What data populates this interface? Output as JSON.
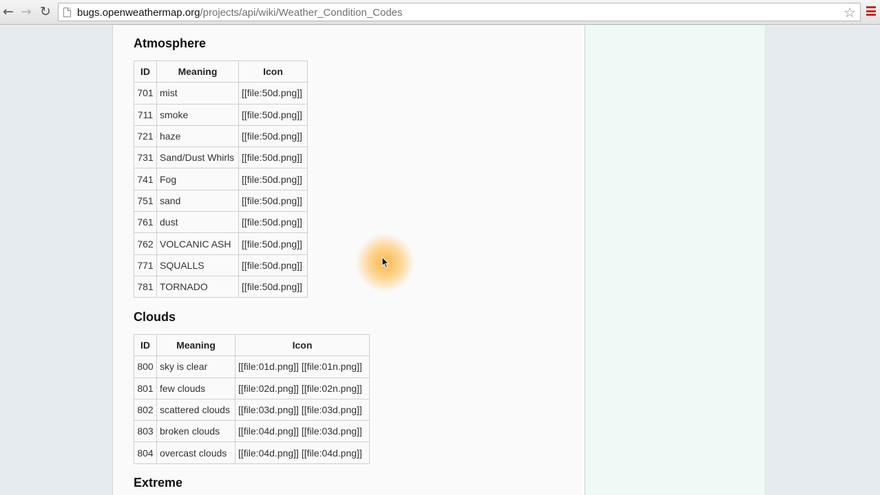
{
  "browser": {
    "url_host": "bugs.openweathermap.org",
    "url_path": "/projects/api/wiki/Weather_Condition_Codes"
  },
  "atmosphere": {
    "title": "Atmosphere",
    "headers": [
      "ID",
      "Meaning",
      "Icon"
    ],
    "rows": [
      [
        "701",
        "mist",
        "[[file:50d.png]]"
      ],
      [
        "711",
        "smoke",
        "[[file:50d.png]]"
      ],
      [
        "721",
        "haze",
        "[[file:50d.png]]"
      ],
      [
        "731",
        "Sand/Dust Whirls",
        "[[file:50d.png]]"
      ],
      [
        "741",
        "Fog",
        "[[file:50d.png]]"
      ],
      [
        "751",
        "sand",
        "[[file:50d.png]]"
      ],
      [
        "761",
        "dust",
        "[[file:50d.png]]"
      ],
      [
        "762",
        "VOLCANIC ASH",
        "[[file:50d.png]]"
      ],
      [
        "771",
        "SQUALLS",
        "[[file:50d.png]]"
      ],
      [
        "781",
        "TORNADO",
        "[[file:50d.png]]"
      ]
    ]
  },
  "clouds": {
    "title": "Clouds",
    "headers": [
      "ID",
      "Meaning",
      "Icon"
    ],
    "rows": [
      [
        "800",
        "sky is clear",
        "[[file:01d.png]] [[file:01n.png]]"
      ],
      [
        "801",
        "few clouds",
        "[[file:02d.png]] [[file:02n.png]]"
      ],
      [
        "802",
        "scattered clouds",
        "[[file:03d.png]] [[file:03d.png]]"
      ],
      [
        "803",
        "broken clouds",
        "[[file:04d.png]] [[file:03d.png]]"
      ],
      [
        "804",
        "overcast clouds",
        "[[file:04d.png]] [[file:04d.png]]"
      ]
    ]
  },
  "extreme": {
    "title": "Extreme"
  }
}
